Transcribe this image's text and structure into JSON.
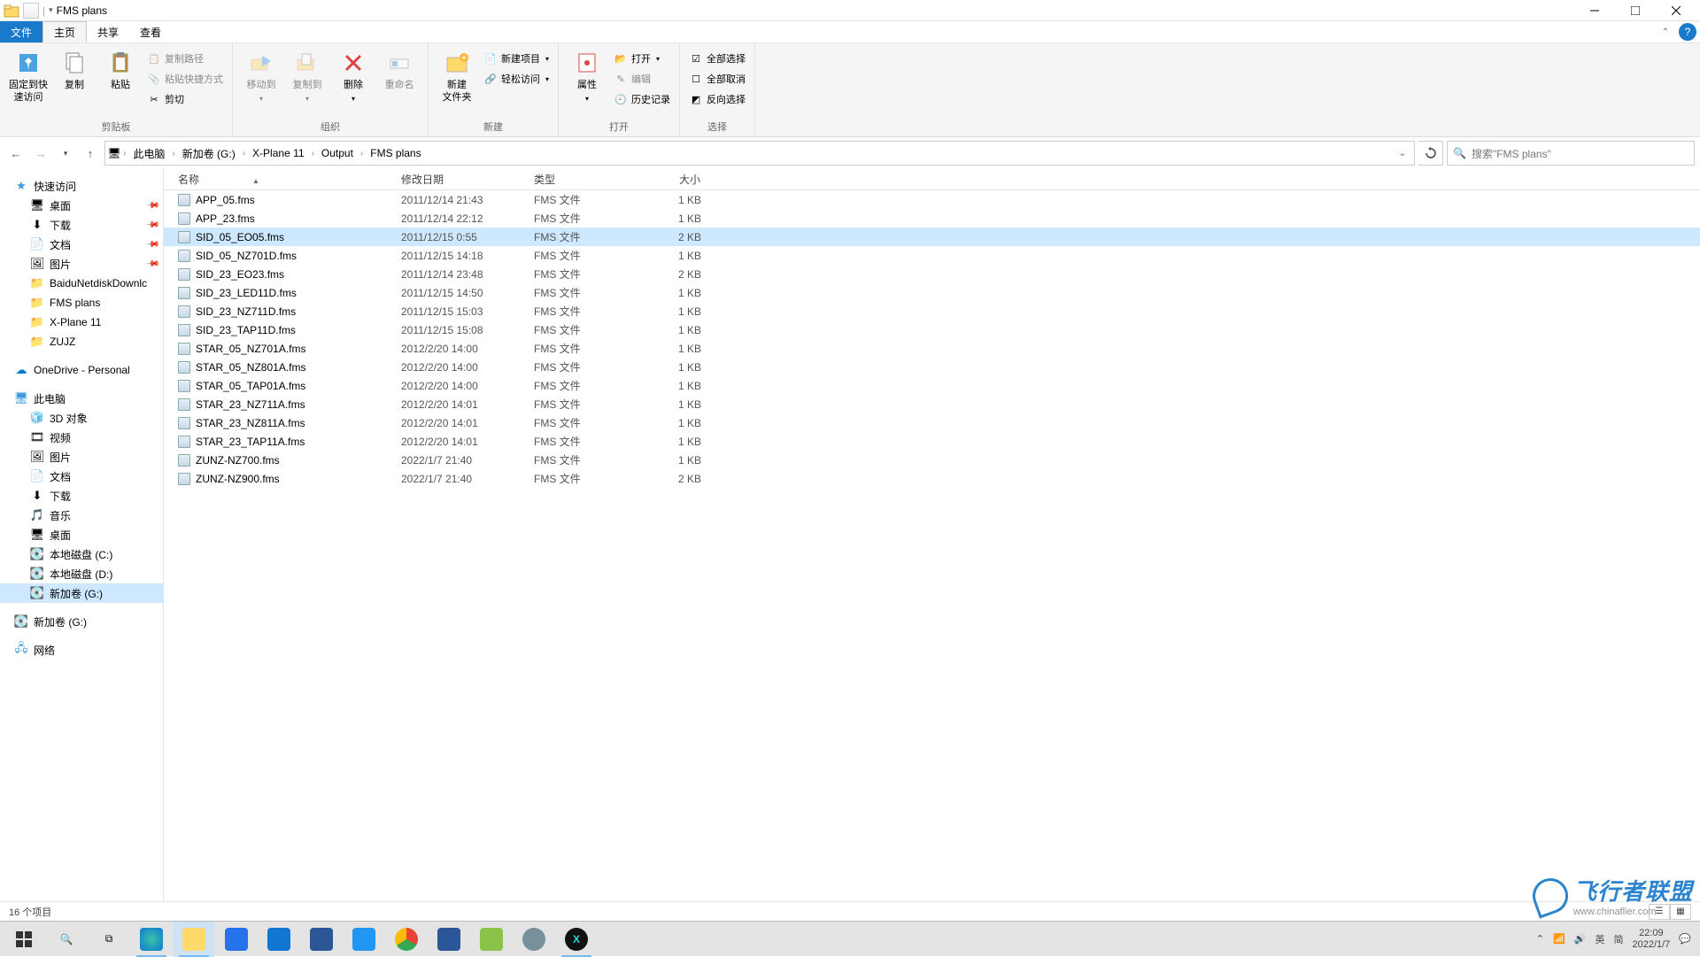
{
  "window": {
    "title": "FMS plans"
  },
  "menutabs": {
    "file": "文件",
    "home": "主页",
    "share": "共享",
    "view": "查看"
  },
  "ribbon": {
    "clipboard": {
      "pin": "固定到快\n速访问",
      "copy": "复制",
      "paste": "粘贴",
      "copypath": "复制路径",
      "pasteshortcut": "粘贴快捷方式",
      "cut": "剪切",
      "label": "剪贴板"
    },
    "organize": {
      "moveto": "移动到",
      "copyto": "复制到",
      "delete": "删除",
      "rename": "重命名",
      "label": "组织"
    },
    "new": {
      "newfolder": "新建\n文件夹",
      "newitem": "新建项目",
      "easyaccess": "轻松访问",
      "label": "新建"
    },
    "open": {
      "properties": "属性",
      "open": "打开",
      "edit": "编辑",
      "history": "历史记录",
      "label": "打开"
    },
    "select": {
      "selectall": "全部选择",
      "selectnone": "全部取消",
      "invert": "反向选择",
      "label": "选择"
    }
  },
  "breadcrumb": [
    "此电脑",
    "新加卷 (G:)",
    "X-Plane 11",
    "Output",
    "FMS plans"
  ],
  "search": {
    "placeholder": "搜索\"FMS plans\""
  },
  "nav": {
    "quick": {
      "header": "快速访问",
      "items": [
        {
          "icon": "desktop",
          "label": "桌面",
          "pin": true
        },
        {
          "icon": "download",
          "label": "下载",
          "pin": true
        },
        {
          "icon": "doc",
          "label": "文档",
          "pin": true
        },
        {
          "icon": "pic",
          "label": "图片",
          "pin": true
        },
        {
          "icon": "folder",
          "label": "BaiduNetdiskDownlc",
          "pin": false
        },
        {
          "icon": "folder",
          "label": "FMS plans",
          "pin": false
        },
        {
          "icon": "folder",
          "label": "X-Plane 11",
          "pin": false
        },
        {
          "icon": "folder",
          "label": "ZUJZ",
          "pin": false
        }
      ]
    },
    "onedrive": "OneDrive - Personal",
    "thispc": {
      "header": "此电脑",
      "items": [
        {
          "icon": "3d",
          "label": "3D 对象"
        },
        {
          "icon": "video",
          "label": "视频"
        },
        {
          "icon": "pic",
          "label": "图片"
        },
        {
          "icon": "doc",
          "label": "文档"
        },
        {
          "icon": "download",
          "label": "下载"
        },
        {
          "icon": "music",
          "label": "音乐"
        },
        {
          "icon": "desktop",
          "label": "桌面"
        },
        {
          "icon": "disk",
          "label": "本地磁盘 (C:)"
        },
        {
          "icon": "disk",
          "label": "本地磁盘 (D:)"
        },
        {
          "icon": "disk",
          "label": "新加卷 (G:)",
          "selected": true
        }
      ]
    },
    "drive_g": "新加卷 (G:)",
    "network": "网络"
  },
  "columns": {
    "name": "名称",
    "date": "修改日期",
    "type": "类型",
    "size": "大小"
  },
  "files": [
    {
      "name": "APP_05.fms",
      "date": "2011/12/14 21:43",
      "type": "FMS 文件",
      "size": "1 KB"
    },
    {
      "name": "APP_23.fms",
      "date": "2011/12/14 22:12",
      "type": "FMS 文件",
      "size": "1 KB"
    },
    {
      "name": "SID_05_EO05.fms",
      "date": "2011/12/15 0:55",
      "type": "FMS 文件",
      "size": "2 KB",
      "selected": true
    },
    {
      "name": "SID_05_NZ701D.fms",
      "date": "2011/12/15 14:18",
      "type": "FMS 文件",
      "size": "1 KB"
    },
    {
      "name": "SID_23_EO23.fms",
      "date": "2011/12/14 23:48",
      "type": "FMS 文件",
      "size": "2 KB"
    },
    {
      "name": "SID_23_LED11D.fms",
      "date": "2011/12/15 14:50",
      "type": "FMS 文件",
      "size": "1 KB"
    },
    {
      "name": "SID_23_NZ711D.fms",
      "date": "2011/12/15 15:03",
      "type": "FMS 文件",
      "size": "1 KB"
    },
    {
      "name": "SID_23_TAP11D.fms",
      "date": "2011/12/15 15:08",
      "type": "FMS 文件",
      "size": "1 KB"
    },
    {
      "name": "STAR_05_NZ701A.fms",
      "date": "2012/2/20 14:00",
      "type": "FMS 文件",
      "size": "1 KB"
    },
    {
      "name": "STAR_05_NZ801A.fms",
      "date": "2012/2/20 14:00",
      "type": "FMS 文件",
      "size": "1 KB"
    },
    {
      "name": "STAR_05_TAP01A.fms",
      "date": "2012/2/20 14:00",
      "type": "FMS 文件",
      "size": "1 KB"
    },
    {
      "name": "STAR_23_NZ711A.fms",
      "date": "2012/2/20 14:01",
      "type": "FMS 文件",
      "size": "1 KB"
    },
    {
      "name": "STAR_23_NZ811A.fms",
      "date": "2012/2/20 14:01",
      "type": "FMS 文件",
      "size": "1 KB"
    },
    {
      "name": "STAR_23_TAP11A.fms",
      "date": "2012/2/20 14:01",
      "type": "FMS 文件",
      "size": "1 KB"
    },
    {
      "name": "ZUNZ-NZ700.fms",
      "date": "2022/1/7 21:40",
      "type": "FMS 文件",
      "size": "1 KB"
    },
    {
      "name": "ZUNZ-NZ900.fms",
      "date": "2022/1/7 21:40",
      "type": "FMS 文件",
      "size": "2 KB"
    }
  ],
  "status": {
    "items": "16 个项目"
  },
  "tray": {
    "ime1": "英",
    "ime2": "简",
    "time": "22:09",
    "date": "2022/1/7"
  },
  "watermark": {
    "main": "飞行者联盟",
    "sub": "www.chinaflier.com"
  }
}
